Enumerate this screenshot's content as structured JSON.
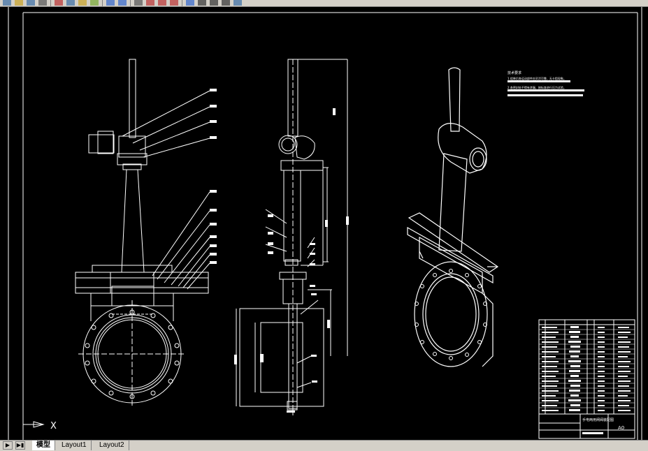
{
  "toolbar": {
    "icons": [
      "new-icon",
      "open-icon",
      "save-icon",
      "print-icon",
      "cut-icon",
      "copy-icon",
      "paste-icon",
      "match-properties-icon",
      "undo-icon",
      "redo-icon",
      "pan-icon",
      "zoom-realtime-icon",
      "zoom-window-icon",
      "zoom-previous-icon",
      "properties-icon",
      "text-style-icon",
      "dim-style-icon",
      "table-icon",
      "layer-icon"
    ],
    "style_label": "A"
  },
  "drawing": {
    "tech_req_title": "技术要求",
    "tech_req_lines": [
      "1.组装后各运动部件应灵活可靠，无卡阻现象。",
      "2.各密封处不得有渗漏，按标准进行压力试验。"
    ],
    "title_block": {
      "name": "手电两用闸阀装配图",
      "scale_label": "A0"
    },
    "ucs_label": "X"
  },
  "tabs": {
    "model": "模型",
    "layout1": "Layout1",
    "layout2": "Layout2"
  },
  "colors": {
    "background": "#000000",
    "lines": "#ffffff",
    "ui_gray": "#d4d0c8"
  }
}
